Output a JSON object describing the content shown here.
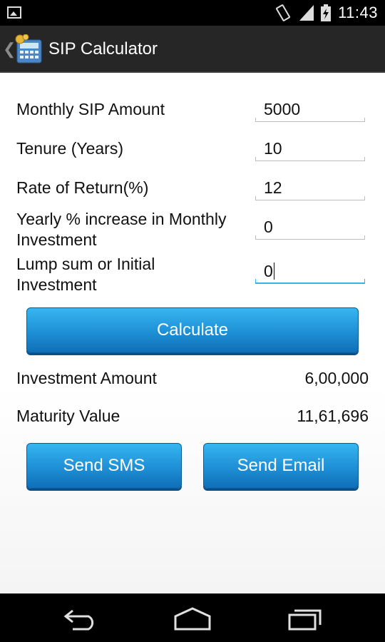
{
  "status_bar": {
    "time": "11:43"
  },
  "action_bar": {
    "title": "SIP Calculator",
    "back_glyph": "❮"
  },
  "form": {
    "fields": [
      {
        "label": "Monthly SIP Amount",
        "value": "5000"
      },
      {
        "label": "Tenure (Years)",
        "value": "10"
      },
      {
        "label": "Rate of Return(%)",
        "value": "12"
      },
      {
        "label_line1": "Yearly % increase in Monthly",
        "label_line2": "Investment",
        "value": "0"
      },
      {
        "label_line1": "Lump sum or Initial",
        "label_line2": "Investment",
        "value": "0"
      }
    ]
  },
  "buttons": {
    "calculate": "Calculate",
    "send_sms": "Send SMS",
    "send_email": "Send Email"
  },
  "results": [
    {
      "label": "Investment Amount",
      "value": "6,00,000"
    },
    {
      "label": "Maturity Value",
      "value": "11,61,696"
    }
  ],
  "colors": {
    "accent": "#33b5e5",
    "button": "#1e8fd6",
    "action_bar": "#262626"
  },
  "icons": {
    "status_left": "image-notification-icon",
    "vibrate": "vibrate-icon",
    "signal": "signal-icon",
    "battery": "battery-icon",
    "nav_back": "back-icon",
    "nav_home": "home-icon",
    "nav_recents": "recents-icon"
  }
}
